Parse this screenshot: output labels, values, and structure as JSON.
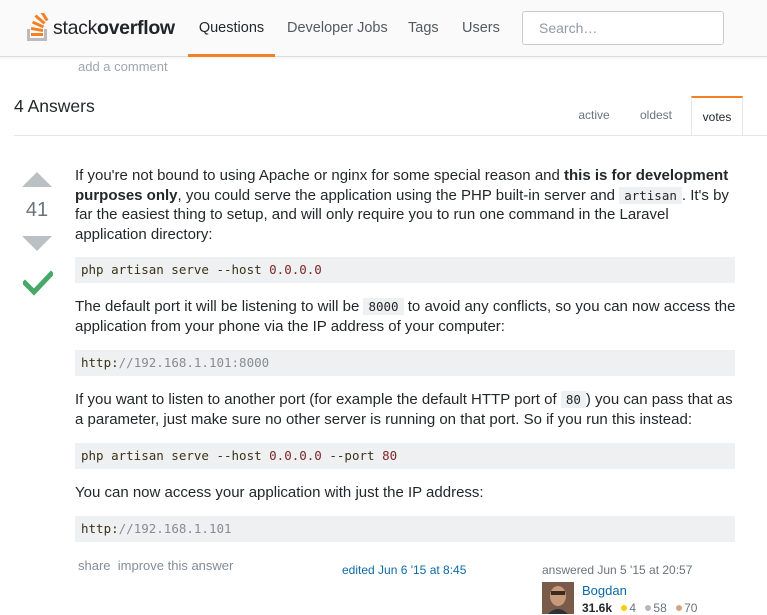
{
  "header": {
    "logo_word1": "stack",
    "logo_word2": "overflow",
    "nav": [
      "Questions",
      "Developer Jobs",
      "Tags",
      "Users"
    ],
    "active_nav": "Questions",
    "search_placeholder": "Search…",
    "accent_color": "#f48024"
  },
  "question": {
    "add_comment": "add a comment"
  },
  "answers": {
    "count_label": "4 Answers",
    "tabs": [
      "active",
      "oldest",
      "votes"
    ],
    "active_tab": "votes"
  },
  "answer": {
    "votes": "41",
    "accepted": true,
    "p1_a": "If you're not bound to using Apache or nginx for some special reason and ",
    "p1_bold": "this is for development purposes only",
    "p1_b": ", you could serve the application using the PHP built-in server and ",
    "p1_code": "artisan",
    "p1_c": ". It's by far the easiest thing to setup, and will only require you to run one command in the Laravel application directory:",
    "code1_a": "php artisan serve --host ",
    "code1_b": "0.0.0.0",
    "p2_a": "The default port it will be listening to will be ",
    "p2_code": "8000",
    "p2_b": " to avoid any conflicts, so you can now access the application from your phone via the IP address of your computer:",
    "code2_a": "http:",
    "code2_b": "//192.168.1.101:8000",
    "p3_a": "If you want to listen to another port (for example the default HTTP port of ",
    "p3_code": "80",
    "p3_b": ") you can pass that as a parameter, just make sure no other server is running on that port. So if you run this instead:",
    "code3_a": "php artisan serve --host ",
    "code3_b": "0.0.0.0",
    "code3_c": " --port ",
    "code3_d": "80",
    "p4": "You can now access your application with just the IP address:",
    "code4_a": "http:",
    "code4_b": "//192.168.1.101",
    "menu_share": "share",
    "menu_improve": "improve this answer",
    "edited": "edited Jun 6 '15 at 8:45",
    "answered": "answered Jun 5 '15 at 20:57",
    "user_name": "Bogdan",
    "user_rep": "31.6k",
    "user_gold": "4",
    "user_silver": "58",
    "user_bronze": "70"
  }
}
